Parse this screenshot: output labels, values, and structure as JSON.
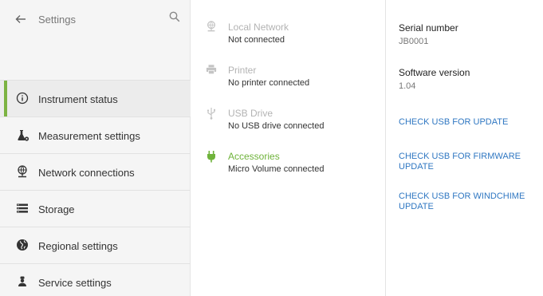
{
  "sidebar": {
    "title": "Settings",
    "back_icon": "arrow-left-icon",
    "search_icon": "search-icon",
    "items": [
      {
        "label": "Instrument status",
        "icon": "info-circle-icon",
        "active": true
      },
      {
        "label": "Measurement settings",
        "icon": "flask-gear-icon",
        "active": false
      },
      {
        "label": "Network connections",
        "icon": "globe-network-icon",
        "active": false
      },
      {
        "label": "Storage",
        "icon": "storage-list-icon",
        "active": false
      },
      {
        "label": "Regional settings",
        "icon": "globe-icon",
        "active": false
      },
      {
        "label": "Service settings",
        "icon": "service-person-icon",
        "active": false
      }
    ]
  },
  "connections": [
    {
      "name": "Local Network",
      "status": "Not connected",
      "icon": "network-icon",
      "connected": false
    },
    {
      "name": "Printer",
      "status": "No printer connected",
      "icon": "printer-icon",
      "connected": false
    },
    {
      "name": "USB Drive",
      "status": "No USB drive connected",
      "icon": "usb-icon",
      "connected": false
    },
    {
      "name": "Accessories",
      "status": "Micro Volume connected",
      "icon": "plug-icon",
      "connected": true
    }
  ],
  "instrument": {
    "serial_label": "Serial number",
    "serial_value": "JB0001",
    "software_label": "Software version",
    "software_value": "1.04"
  },
  "actions": [
    {
      "label": "CHECK USB FOR UPDATE"
    },
    {
      "label": "CHECK USB FOR FIRMWARE UPDATE"
    },
    {
      "label": "CHECK USB FOR WINDCHIME UPDATE"
    }
  ],
  "colors": {
    "accent_green": "#7cb342",
    "link_blue": "#2f77c2",
    "sidebar_bg": "#f5f5f5"
  }
}
